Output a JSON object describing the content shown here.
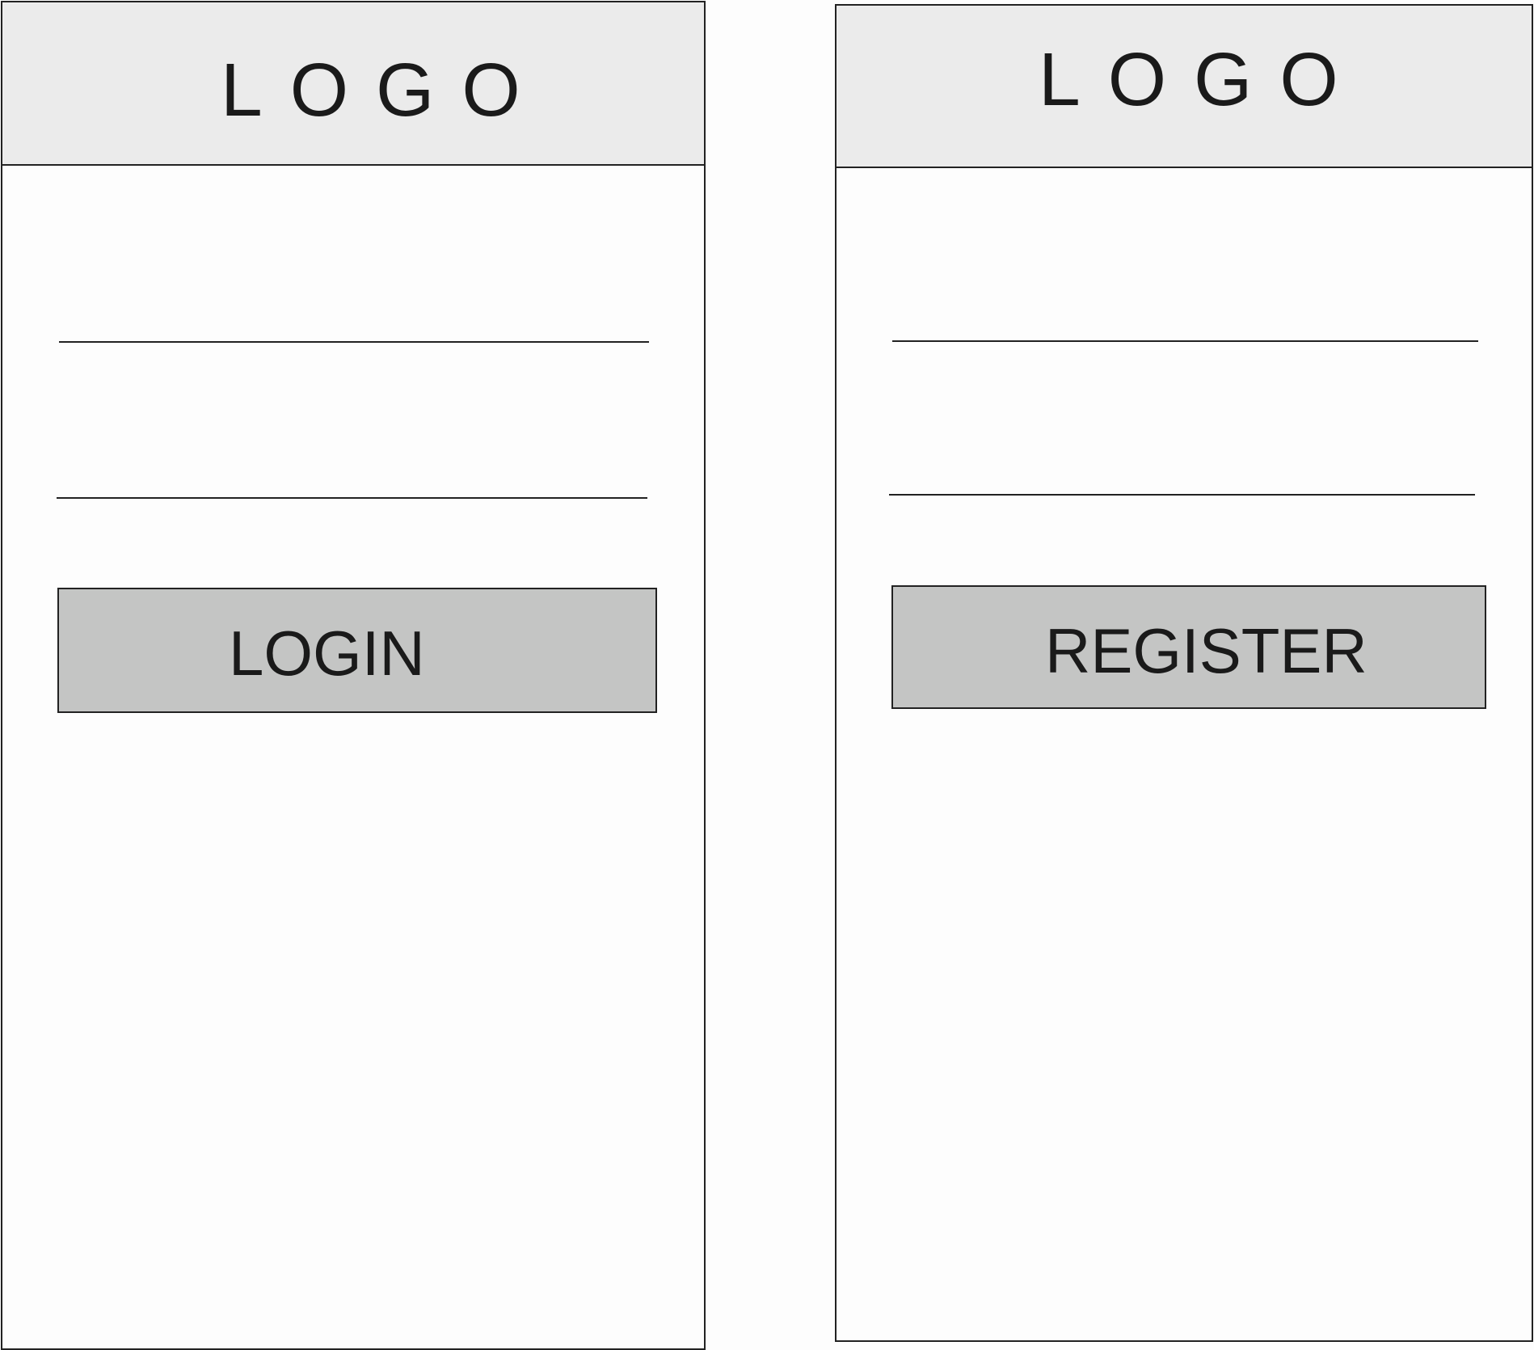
{
  "login_screen": {
    "logo": "LOGO",
    "button_label": "LOGIN"
  },
  "register_screen": {
    "logo": "LOGO",
    "button_label": "REGISTER"
  }
}
